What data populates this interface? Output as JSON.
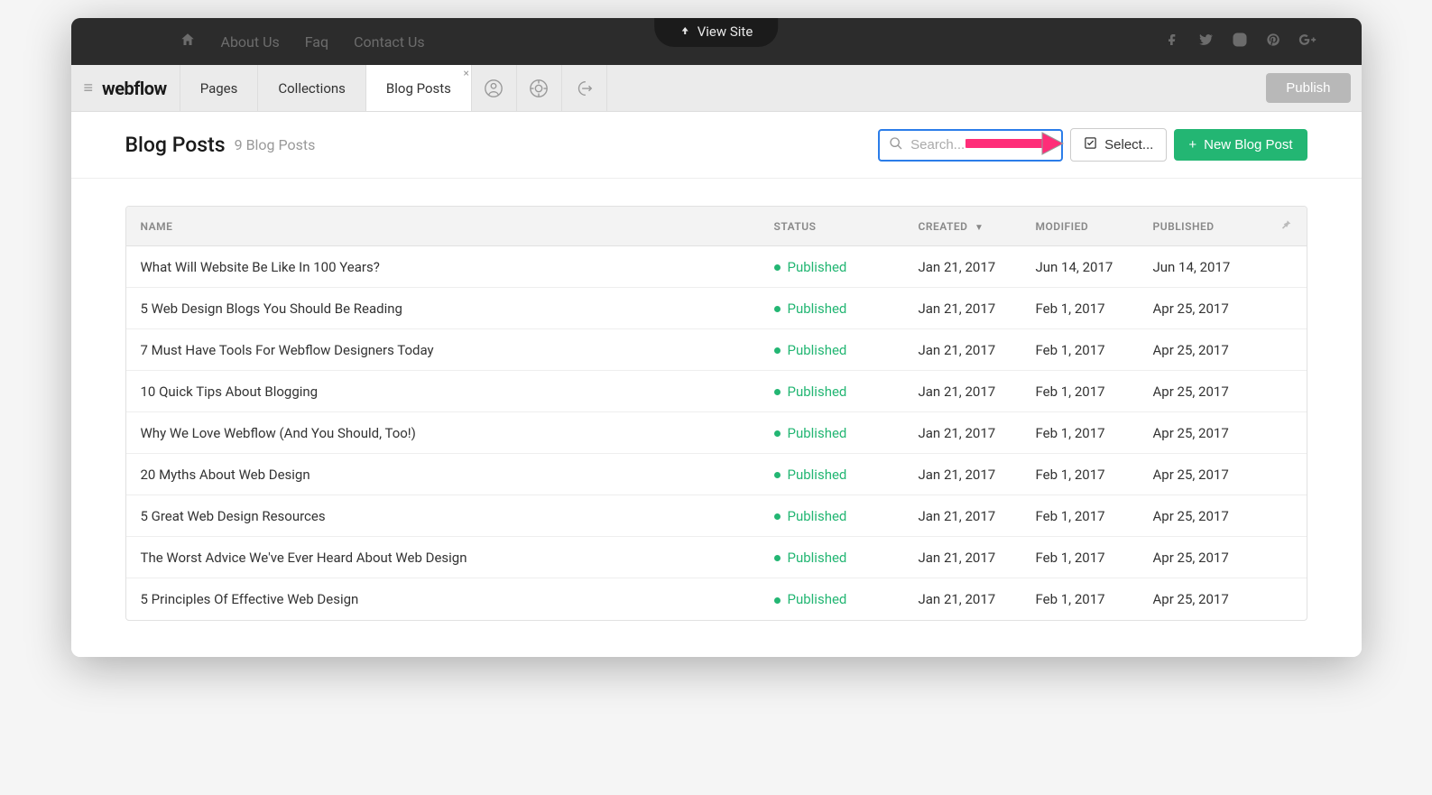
{
  "overlay": {
    "view_site": "View Site"
  },
  "site_nav": {
    "home_icon": "home",
    "items": [
      "About Us",
      "Faq",
      "Contact Us"
    ],
    "social": [
      "facebook",
      "twitter",
      "instagram",
      "pinterest",
      "google-plus"
    ]
  },
  "editor": {
    "logo": "webflow",
    "tabs": {
      "pages": "Pages",
      "collections": "Collections",
      "blog_posts": "Blog Posts"
    },
    "publish_label": "Publish"
  },
  "page": {
    "title": "Blog Posts",
    "subtitle": "9 Blog Posts",
    "search_placeholder": "Search...",
    "select_label": "Select...",
    "new_post_label": "New Blog Post"
  },
  "table": {
    "headers": {
      "name": "NAME",
      "status": "STATUS",
      "created": "CREATED",
      "modified": "MODIFIED",
      "published": "PUBLISHED"
    },
    "status_label": "Published",
    "rows": [
      {
        "name": "What Will Website Be Like In 100 Years?",
        "created": "Jan 21, 2017",
        "modified": "Jun 14, 2017",
        "published": "Jun 14, 2017"
      },
      {
        "name": "5 Web Design Blogs You Should Be Reading",
        "created": "Jan 21, 2017",
        "modified": "Feb 1, 2017",
        "published": "Apr 25, 2017"
      },
      {
        "name": "7 Must Have Tools For Webflow Designers Today",
        "created": "Jan 21, 2017",
        "modified": "Feb 1, 2017",
        "published": "Apr 25, 2017"
      },
      {
        "name": "10 Quick Tips About Blogging",
        "created": "Jan 21, 2017",
        "modified": "Feb 1, 2017",
        "published": "Apr 25, 2017"
      },
      {
        "name": "Why We Love Webflow (And You Should, Too!)",
        "created": "Jan 21, 2017",
        "modified": "Feb 1, 2017",
        "published": "Apr 25, 2017"
      },
      {
        "name": "20 Myths About Web Design",
        "created": "Jan 21, 2017",
        "modified": "Feb 1, 2017",
        "published": "Apr 25, 2017"
      },
      {
        "name": "5 Great Web Design Resources",
        "created": "Jan 21, 2017",
        "modified": "Feb 1, 2017",
        "published": "Apr 25, 2017"
      },
      {
        "name": "The Worst Advice We've Ever Heard About Web Design",
        "created": "Jan 21, 2017",
        "modified": "Feb 1, 2017",
        "published": "Apr 25, 2017"
      },
      {
        "name": "5 Principles Of Effective Web Design",
        "created": "Jan 21, 2017",
        "modified": "Feb 1, 2017",
        "published": "Apr 25, 2017"
      }
    ]
  }
}
